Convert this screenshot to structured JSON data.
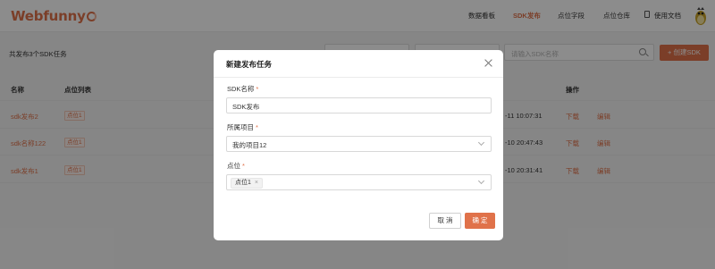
{
  "header": {
    "logo_text": "Webfunny",
    "nav": [
      "数据看板",
      "SDK发布",
      "点位字段",
      "点位仓库",
      "使用文档"
    ],
    "active_nav": "SDK发布"
  },
  "toolbar": {
    "total_text": "共发布3个SDK任务",
    "search_placeholder": "请输入SDK名称",
    "create_label": "+ 创建SDK"
  },
  "table": {
    "headers": {
      "name": "名称",
      "points": "点位列表",
      "actions": "操作"
    },
    "rows": [
      {
        "name": "sdk发布2",
        "point": "点位1",
        "time": "-11 10:07:31",
        "download": "下载",
        "edit": "编辑"
      },
      {
        "name": "sdk名称122",
        "point": "点位1",
        "time": "-10 20:47:43",
        "download": "下载",
        "edit": "编辑"
      },
      {
        "name": "sdk发布1",
        "point": "点位1",
        "time": "-10 20:31:41",
        "download": "下载",
        "edit": "编辑"
      }
    ]
  },
  "modal": {
    "title": "新建发布任务",
    "fields": {
      "sdk_name": {
        "label": "SDK名称",
        "value": "SDK发布"
      },
      "project": {
        "label": "所属项目",
        "value": "我的项目12"
      },
      "points": {
        "label": "点位",
        "chip": "点位1",
        "chip_close": "×"
      }
    },
    "required_mark": "*",
    "cancel_label": "取 消",
    "ok_label": "确 定"
  },
  "colors": {
    "accent": "#e0724a"
  }
}
